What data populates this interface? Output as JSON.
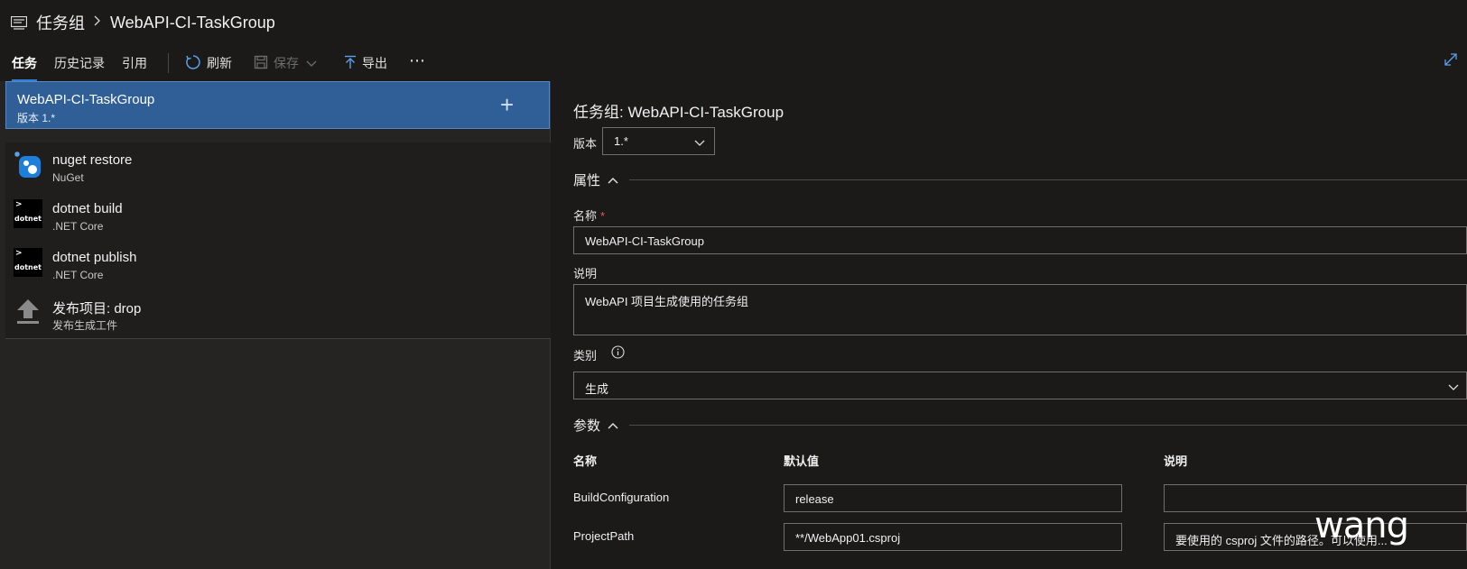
{
  "breadcrumb": {
    "root": "任务组",
    "title": "WebAPI-CI-TaskGroup"
  },
  "toolbar": {
    "tabs": [
      {
        "label": "任务",
        "active": true
      },
      {
        "label": "历史记录",
        "active": false
      },
      {
        "label": "引用",
        "active": false
      }
    ],
    "refresh_label": "刷新",
    "save_label": "保存",
    "export_label": "导出",
    "more_label": "⋯"
  },
  "taskgroup": {
    "name": "WebAPI-CI-TaskGroup",
    "version": "版本 1.*",
    "add_label": "+"
  },
  "tasks": [
    {
      "name": "nuget restore",
      "subtitle": "NuGet",
      "icon": "nuget-icon"
    },
    {
      "name": "dotnet build",
      "subtitle": ".NET Core",
      "icon": "dotnet-icon"
    },
    {
      "name": "dotnet publish",
      "subtitle": ".NET Core",
      "icon": "dotnet-icon"
    },
    {
      "name": "发布项目: drop",
      "subtitle": "发布生成工件",
      "icon": "upload-icon"
    }
  ],
  "dotnet_badge_text": "dotnet",
  "detail": {
    "title": "任务组: WebAPI-CI-TaskGroup",
    "version_label": "版本",
    "version_value": "1.*",
    "properties_label": "属性",
    "name_label": "名称",
    "required_mark": "*",
    "name_value": "WebAPI-CI-TaskGroup",
    "description_label": "说明",
    "description_value": "WebAPI 项目生成使用的任务组",
    "category_label": "类别",
    "category_value": "生成",
    "parameters_label": "参数",
    "params_columns": {
      "name": "名称",
      "default": "默认值",
      "description": "说明"
    },
    "params": [
      {
        "name": "BuildConfiguration",
        "default": "release",
        "description": ""
      },
      {
        "name": "ProjectPath",
        "default": "**/WebApp01.csproj",
        "description": "要使用的 csproj 文件的路径。可以使用..."
      }
    ]
  },
  "watermark": "wang",
  "colors": {
    "accent": "#2f7fd8",
    "selected_bg": "#2f5f96",
    "page_bg": "#1b1a19",
    "required": "#e05a5a"
  }
}
